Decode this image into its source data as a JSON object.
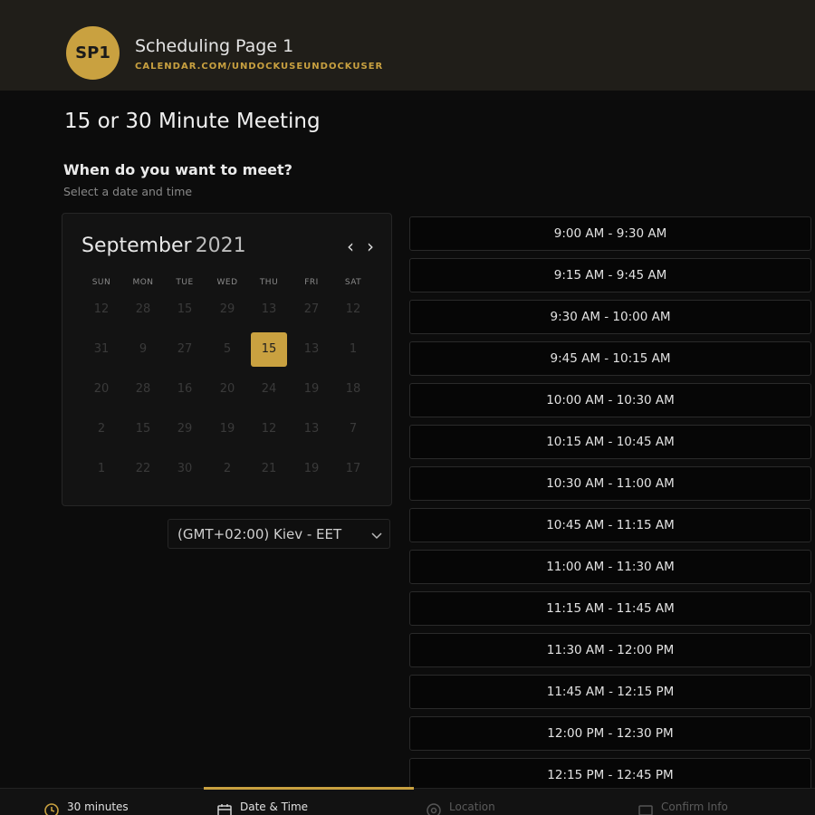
{
  "header": {
    "avatar_initials": "SP1",
    "page_name": "Scheduling Page 1",
    "page_url": "CALENDAR.COM/UNDOCKUSEUNDOCKUSER"
  },
  "title": "15 or 30 Minute Meeting",
  "question": "When do you want to meet?",
  "hint": "Select a date and time",
  "calendar": {
    "month": "September",
    "year": "2021",
    "prev_icon": "chevron-left-icon",
    "next_icon": "chevron-right-icon",
    "weekdays": [
      "SUN",
      "MON",
      "TUE",
      "WED",
      "THU",
      "FRI",
      "SAT"
    ],
    "rows": [
      [
        "12",
        "28",
        "15",
        "29",
        "13",
        "27",
        "12"
      ],
      [
        "31",
        "9",
        "27",
        "5",
        "15",
        "13",
        "1"
      ],
      [
        "20",
        "28",
        "16",
        "20",
        "24",
        "19",
        "18"
      ],
      [
        "2",
        "15",
        "29",
        "19",
        "12",
        "13",
        "7"
      ],
      [
        "1",
        "22",
        "30",
        "2",
        "21",
        "19",
        "17"
      ]
    ],
    "selected_day": "15"
  },
  "timezone": {
    "value": "(GMT+02:00) Kiev - EET",
    "icon": "chevron-down-icon"
  },
  "slots": [
    "9:00 AM - 9:30 AM",
    "9:15 AM - 9:45 AM",
    "9:30 AM - 10:00 AM",
    "9:45 AM - 10:15 AM",
    "10:00 AM - 10:30 AM",
    "10:15 AM - 10:45 AM",
    "10:30 AM - 11:00 AM",
    "10:45 AM - 11:15 AM",
    "11:00 AM - 11:30 AM",
    "11:15 AM - 11:45 AM",
    "11:30 AM - 12:00 PM",
    "11:45 AM - 12:15 PM",
    "12:00 PM - 12:30 PM",
    "12:15 PM - 12:45 PM"
  ],
  "footer": {
    "steps": [
      {
        "label": "30 minutes",
        "icon": "clock-icon",
        "state": "done"
      },
      {
        "label": "Date & Time",
        "icon": "calendar-icon",
        "state": "active"
      },
      {
        "label": "Location",
        "icon": "location-icon",
        "state": "pending"
      },
      {
        "label": "Confirm Info",
        "icon": "card-icon",
        "state": "pending"
      }
    ]
  },
  "colors": {
    "accent": "#c9a140",
    "background": "#0c0c0c",
    "header": "#201e19"
  }
}
